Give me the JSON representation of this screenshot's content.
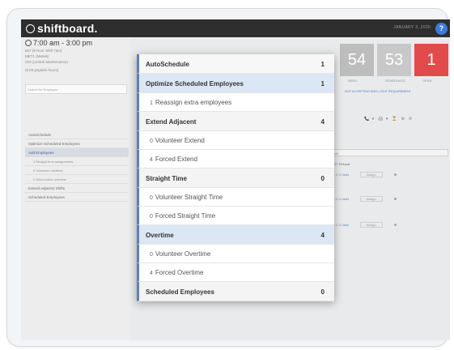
{
  "app": {
    "logo": "shiftboard.",
    "date": "JANUARY 3, 2020",
    "help": "?"
  },
  "shift": {
    "time": "7:00 am - 3:00 pm",
    "meta": [
      "507 (8 Hour Shift 7am)",
      "MET1 (Metals)",
      "CM (Central Maintenance)"
    ],
    "hours": "(8.00 payable hours)",
    "search_placeholder": "Search for Employee"
  },
  "left_nav": [
    {
      "label": "AutoSchedule",
      "sub": false
    },
    {
      "label": "Optimize Scheduled Employees",
      "sub": false
    },
    {
      "label": "Add Employees",
      "sub": false,
      "active": true
    },
    {
      "label": "4 Straight time assignments",
      "sub": true
    },
    {
      "label": "0 Volunteer overtime",
      "sub": true
    },
    {
      "label": "0 Short notice overtime",
      "sub": true
    },
    {
      "label": "Extend Adjacent Shifts",
      "sub": false
    },
    {
      "label": "Scheduled Employees",
      "sub": false
    }
  ],
  "tiles": [
    {
      "value": "54",
      "label": "NEED",
      "color": "#bdbdbd"
    },
    {
      "value": "53",
      "label": "SCHEDULED",
      "color": "#c8c8c8"
    },
    {
      "value": "1",
      "label": "OPEN",
      "color": "#e24b4b"
    }
  ],
  "right_links": "NOT ACCEPTING BIDS • EDIT REQUIREMENT",
  "tools": [
    "📞 ▾",
    "🖨 ▾",
    "⏳",
    "⚙",
    "⟳"
  ],
  "bg_select": "Shift",
  "bg_headers": "ST    OT    Refusal",
  "bg_rows": [
    {
      "left": "0.00   0.00",
      "add": "Add",
      "assign": "Assign",
      "mark": "❶"
    },
    {
      "left": "0.00   0.00",
      "add": "Add",
      "assign": "Assign",
      "mark": "❶"
    },
    {
      "left": "0.00   0.00",
      "add": "Add",
      "assign": "Assign",
      "mark": "❶"
    }
  ],
  "popup": {
    "rows": [
      {
        "type": "group",
        "label": "AutoSchedule",
        "count": "1",
        "first": true
      },
      {
        "type": "group",
        "label": "Optimize Scheduled Employees",
        "count": "1",
        "highlight": true
      },
      {
        "type": "sub",
        "cnt": "1",
        "label": "Reassign extra employees"
      },
      {
        "type": "group",
        "label": "Extend Adjacent",
        "count": "4"
      },
      {
        "type": "sub",
        "cnt": "0",
        "label": "Volunteer Extend"
      },
      {
        "type": "sub",
        "cnt": "4",
        "label": "Forced Extend"
      },
      {
        "type": "group",
        "label": "Straight Time",
        "count": "0"
      },
      {
        "type": "sub",
        "cnt": "0",
        "label": "Volunteer Straight Time"
      },
      {
        "type": "sub",
        "cnt": "0",
        "label": "Forced Straight Time"
      },
      {
        "type": "group",
        "label": "Overtime",
        "count": "4",
        "highlight": true
      },
      {
        "type": "sub",
        "cnt": "0",
        "label": "Volunteer Overtime"
      },
      {
        "type": "sub",
        "cnt": "4",
        "label": "Forced Overtime"
      },
      {
        "type": "group",
        "label": "Scheduled Employees",
        "count": "0"
      }
    ]
  }
}
